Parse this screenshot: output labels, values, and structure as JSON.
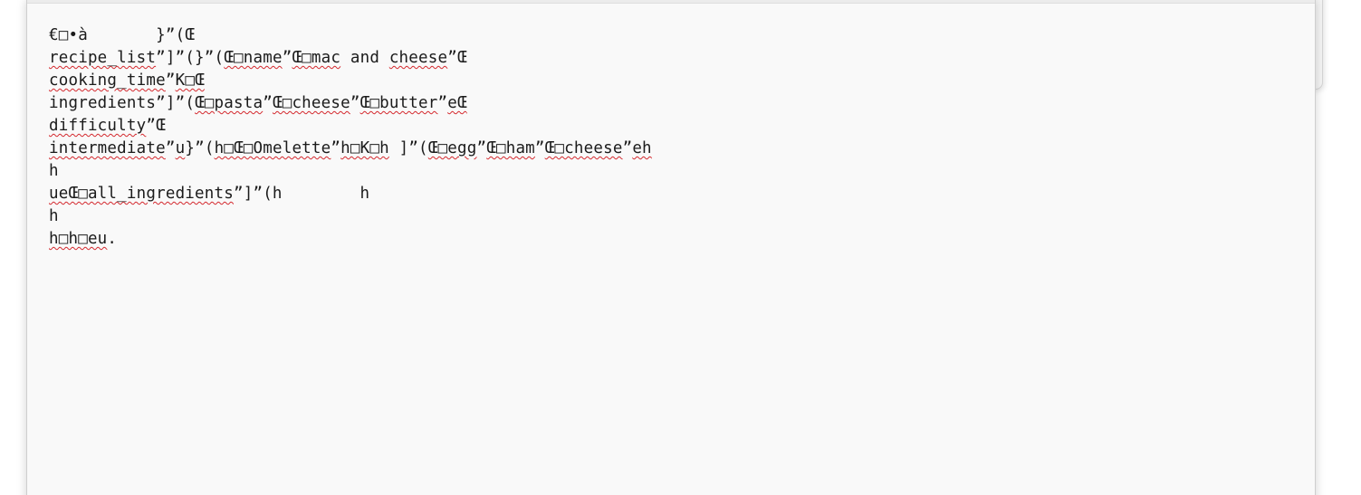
{
  "editor": {
    "lines": [
      [
        {
          "t": "€\u0001•à       }”(Œ",
          "s": false
        }
      ],
      [
        {
          "t": "recipe_list",
          "s": true
        },
        {
          "t": "”]”(}”(",
          "s": false
        },
        {
          "t": "Œ\u0004name",
          "s": true
        },
        {
          "t": "”",
          "s": false
        },
        {
          "t": "Œ\u0010mac",
          "s": true
        },
        {
          "t": " and ",
          "s": false
        },
        {
          "t": "cheese",
          "s": true
        },
        {
          "t": "”Œ",
          "s": false
        }
      ],
      [
        {
          "t": "cooking_time",
          "s": true
        },
        {
          "t": "”",
          "s": false
        },
        {
          "t": "K\u0014Œ",
          "s": true
        }
      ],
      [
        {
          "t": "ingredients",
          "s": false
        },
        {
          "t": "”]”(",
          "s": false
        },
        {
          "t": "Œ\u0005pasta",
          "s": true
        },
        {
          "t": "”",
          "s": false
        },
        {
          "t": "Œ\u0006cheese",
          "s": true
        },
        {
          "t": "”",
          "s": false
        },
        {
          "t": "Œ\u0006butter",
          "s": true
        },
        {
          "t": "”",
          "s": false
        },
        {
          "t": "eŒ",
          "s": true
        }
      ],
      [
        {
          "t": "difficulty",
          "s": true
        },
        {
          "t": "”Œ",
          "s": false
        }
      ],
      [
        {
          "t": "intermediate",
          "s": true
        },
        {
          "t": "”",
          "s": false
        },
        {
          "t": "u",
          "s": true
        },
        {
          "t": "}”(",
          "s": false
        },
        {
          "t": "h\u0006Œ\u0007Omelette",
          "s": true
        },
        {
          "t": "”",
          "s": false
        },
        {
          "t": "h\bK\nh",
          "s": true
        },
        {
          "t": " ]”(",
          "s": false
        },
        {
          "t": "Œ\u0003egg",
          "s": true
        },
        {
          "t": "”",
          "s": false
        },
        {
          "t": "Œ\u0003ham",
          "s": true
        },
        {
          "t": "”",
          "s": false
        },
        {
          "t": "Œ\u0006cheese",
          "s": true
        },
        {
          "t": "”",
          "s": false
        },
        {
          "t": "eh",
          "s": true
        }
      ],
      [
        {
          "t": "h",
          "s": false
        }
      ],
      [
        {
          "t": "ueŒ\u000fall_ingredients",
          "s": true
        },
        {
          "t": "”]”(h        h",
          "s": false
        }
      ],
      [
        {
          "t": "h",
          "s": false
        }
      ],
      [
        {
          "t": "h\u000eh\u0010eu",
          "s": true
        },
        {
          "t": ".",
          "s": false
        }
      ]
    ]
  },
  "colors": {
    "editor_background": "#f9f9f9",
    "text": "#1b1b1b",
    "spellcheck_underline": "#d4282d"
  }
}
